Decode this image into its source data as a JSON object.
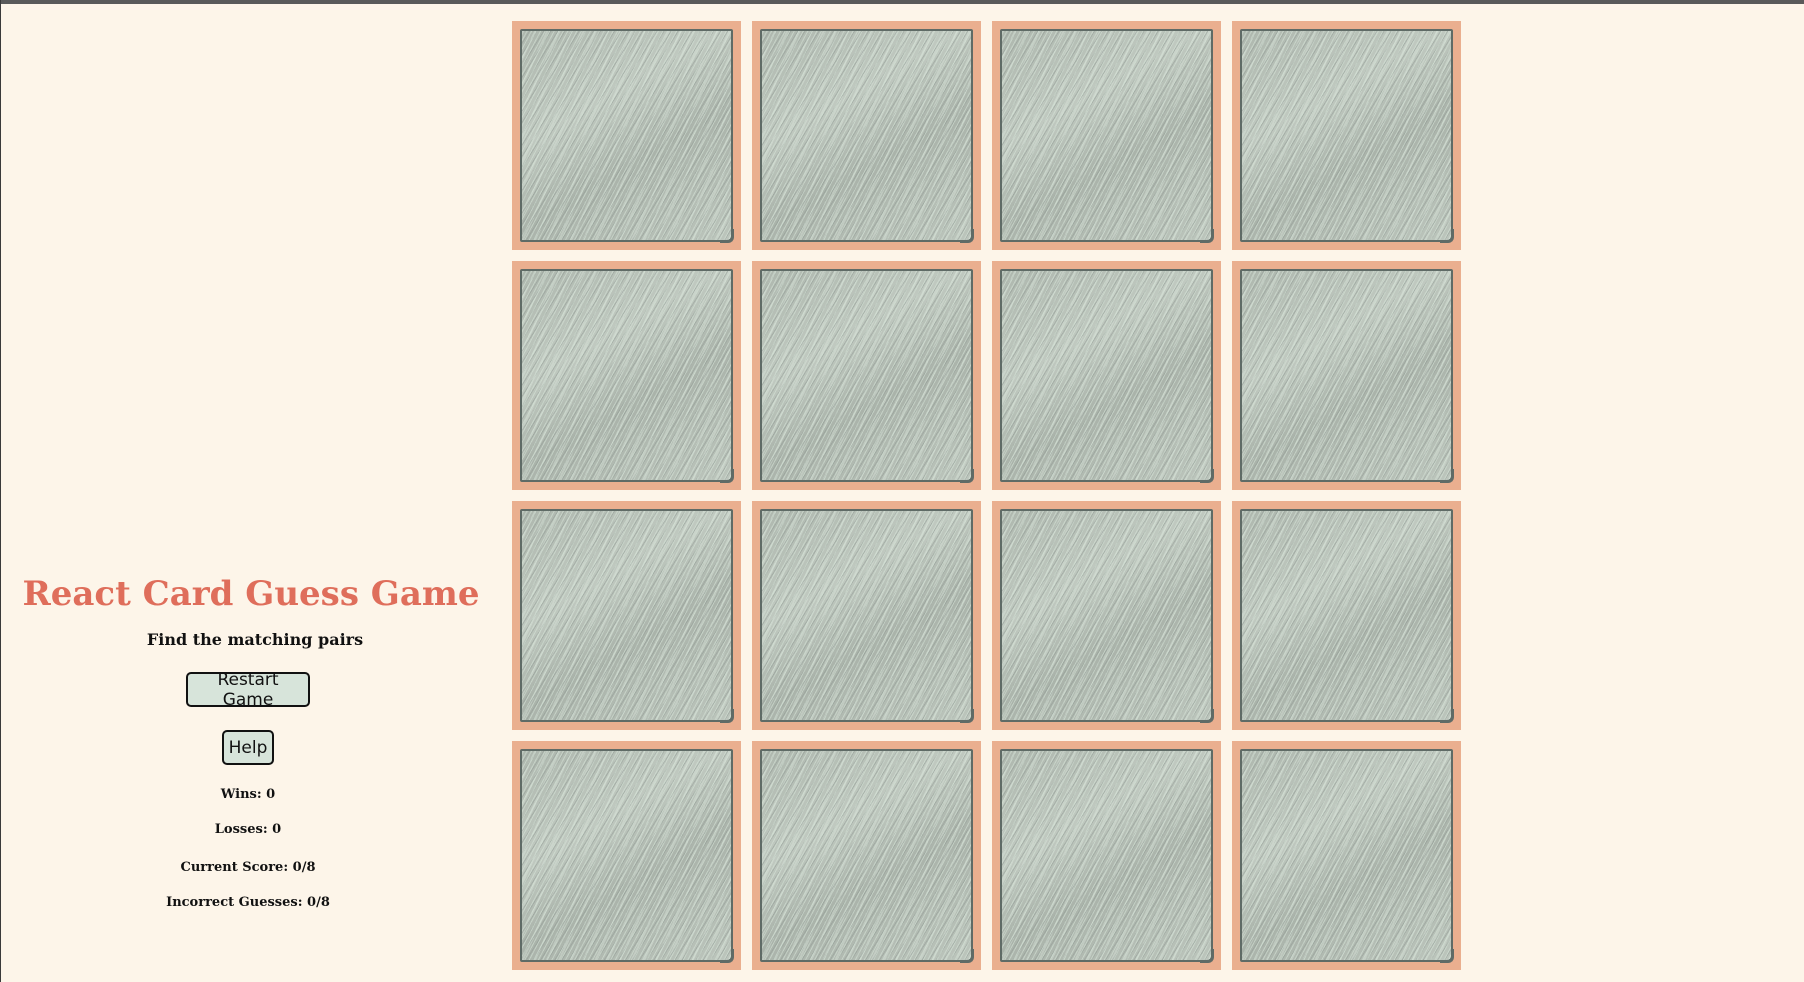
{
  "game": {
    "title": "React Card Guess Game",
    "subtitle": "Find the matching pairs"
  },
  "controls": {
    "restart_label": "Restart Game",
    "help_label": "Help"
  },
  "stats": {
    "wins": "Wins: 0",
    "losses": "Losses: 0",
    "current_score": "Current Score: 0/8",
    "incorrect_guesses": "Incorrect Guesses: 0/8"
  },
  "board": {
    "rows": 4,
    "columns": 4,
    "cards": [
      {
        "state": "face-down"
      },
      {
        "state": "face-down"
      },
      {
        "state": "face-down"
      },
      {
        "state": "face-down"
      },
      {
        "state": "face-down"
      },
      {
        "state": "face-down"
      },
      {
        "state": "face-down"
      },
      {
        "state": "face-down"
      },
      {
        "state": "face-down"
      },
      {
        "state": "face-down"
      },
      {
        "state": "face-down"
      },
      {
        "state": "face-down"
      },
      {
        "state": "face-down"
      },
      {
        "state": "face-down"
      },
      {
        "state": "face-down"
      },
      {
        "state": "face-down"
      }
    ]
  },
  "colors": {
    "background": "#fdf5e9",
    "title": "#df6e5b",
    "card_border": "#eaaf8f",
    "card_back": "#b3bcb3",
    "button_bg": "#d7e4da"
  }
}
